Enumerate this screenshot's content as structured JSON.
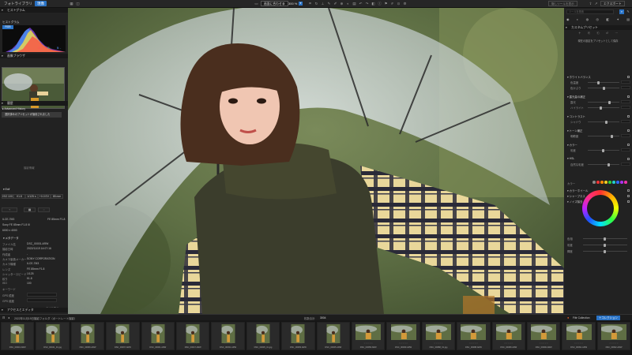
{
  "app": {
    "tabs": [
      {
        "label": "フォトライブラリ"
      },
      {
        "label": "現像"
      }
    ],
    "toolbar": {
      "fit_label": "画面に合わせる",
      "zoom_value": "300 %",
      "hidden_tools_label": "隠しツールを表示",
      "export_label": "エクスポート"
    }
  },
  "left_panel": {
    "navigator_header": "ヒストグラム",
    "histogram_label": "ヒストグラム",
    "histogram_mode": "RGB",
    "hist_readouts": [
      "R: -",
      "G: -",
      "B: -"
    ],
    "preview_header": "画像ブラウザ",
    "history_header": "履歴",
    "history_group": "Advanced History",
    "history_item": "選択済みのプリセットが適用されました",
    "info_header": "撮影情報",
    "exif_header": "Exif",
    "exif_cells": [
      "ISO 100",
      "f/1.8",
      "1/125 s",
      "+0.0 EV",
      "85 mm"
    ],
    "camera_model": "ILCE-7M3",
    "lens_model": "FE 85mm F1.8",
    "lens_line": "Sony FE 85mm F1.8 III",
    "dimensions": "6000 x 4000",
    "metadata_header": "メタデータ",
    "metadata_rows": [
      {
        "label": "ファイル名",
        "value": "DSC_00001.ARW"
      },
      {
        "label": "撮影日時",
        "value": "2022/11/19 14:07:16"
      },
      {
        "label": "作成者",
        "value": "-"
      },
      {
        "label": "カメラ製造メーカー",
        "value": "SONY CORPORATION"
      },
      {
        "label": "カメラ機種",
        "value": "ILCE-7M3"
      },
      {
        "label": "レンズ",
        "value": "FE 85mm F1.8"
      },
      {
        "label": "シャッタースピード",
        "value": "1/125"
      },
      {
        "label": "絞り",
        "value": "f/1.8"
      },
      {
        "label": "ISO",
        "value": "100"
      },
      {
        "label": "キーワード",
        "value": ""
      }
    ],
    "gps_label": "GPS 緯度",
    "gps2_label": "GPS 経度",
    "footer_link": "すべて表示",
    "bottom_header": "アクセスとエディタ"
  },
  "right_panel": {
    "search_placeholder": "ツールを検索",
    "preset_header": "カスタムプリセット",
    "preset_text": "現在の設定をプリセットとして保存",
    "sections": [
      "ホワイトバランス",
      "露光量の補正",
      "コントラスト",
      "トーン補正",
      "カラー",
      "HSL",
      "カラーホイール",
      "シャープネス",
      "ノイズ除去"
    ],
    "slider_labels": [
      "色温度",
      "色かぶり",
      "露光",
      "ハイライト",
      "シャドウ",
      "明瞭度",
      "彩度",
      "自然な彩度"
    ],
    "color_row_label": "カラー",
    "wheel_labels": [
      "色相",
      "彩度",
      "輝度"
    ]
  },
  "filmbar": {
    "path": "2022年11月19日撮影フォルダ（ポートレート撮影）",
    "count_label": "枚数合計",
    "count": "3004",
    "collection_label": "Filtr Collection",
    "collection_action": "＋コレクション"
  },
  "filmstrip": {
    "frames": [
      {
        "name": "DSC_00016.ARW"
      },
      {
        "name": "DSC_00041_01.jpg"
      },
      {
        "name": "DSC_00066.ARW"
      },
      {
        "name": "DSC_00067.ARW"
      },
      {
        "name": "DSC_00001.ARW"
      },
      {
        "name": "DSC_00047.ARW"
      },
      {
        "name": "DSC_00031.ARW"
      },
      {
        "name": "DSC_00035_01.jpg"
      },
      {
        "name": "DSC_00083.ARW"
      },
      {
        "name": "DSC_00005.ARW"
      },
      {
        "name": "DSC_00058.ARW"
      },
      {
        "name": "DSC_00009.ARW"
      },
      {
        "name": "DSC_00088_01.jpg"
      },
      {
        "name": "DSC_00088.ARW"
      },
      {
        "name": "DSC_00089.ARW"
      },
      {
        "name": "DSC_00090.ARW"
      },
      {
        "name": "DSC_00091.ARW"
      },
      {
        "name": "DSC_00092.ARW"
      }
    ]
  },
  "colors": {
    "accent": "#2a73c6",
    "panel": "#222222",
    "background": "#1b1b1b"
  }
}
